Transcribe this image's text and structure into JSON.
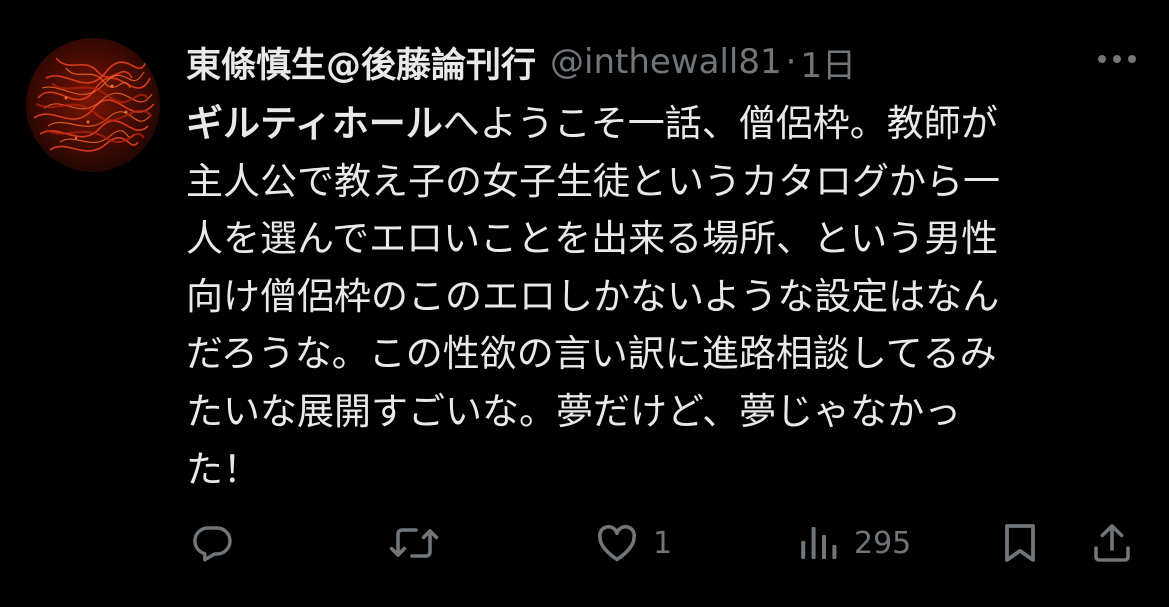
{
  "tweet": {
    "author_name": "東條慎生@後藤論刊行",
    "handle": "@inthewall81",
    "separator": "·",
    "time": "1日",
    "body_lines": [
      {
        "bold": "ギルティホール",
        "rest": "へようこそ一話、僧侶枠。教師が"
      },
      {
        "bold": "",
        "rest": "主人公で教え子の女子生徒というカタログから一"
      },
      {
        "bold": "",
        "rest": "人を選んでエロいことを出来る場所、という男性"
      },
      {
        "bold": "",
        "rest": "向け僧侶枠のこのエロしかないような設定はなん"
      },
      {
        "bold": "",
        "rest": "だろうな。この性欲の言い訳に進路相談してるみ"
      },
      {
        "bold": "",
        "rest": "たいな展開すごいな。夢だけど、夢じゃなかっ"
      },
      {
        "bold": "",
        "rest": "た！"
      }
    ],
    "actions": {
      "reply_icon": "reply-icon",
      "retweet_icon": "retweet-icon",
      "like_icon": "heart-icon",
      "like_count": "1",
      "views_icon": "views-icon",
      "views_count": "295",
      "bookmark_icon": "bookmark-icon",
      "share_icon": "share-icon"
    },
    "colors": {
      "background": "#000000",
      "text": "#e7e9ea",
      "muted": "#71767b"
    }
  }
}
